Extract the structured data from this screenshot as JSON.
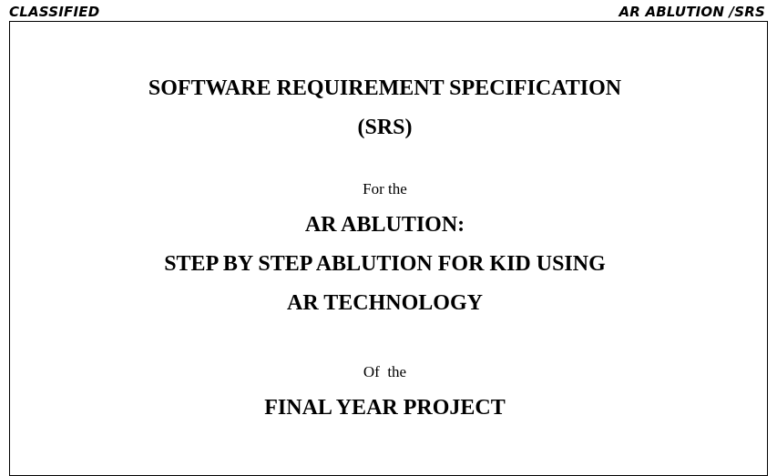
{
  "header": {
    "left": "CLASSIFIED",
    "right": "AR ABLUTION /SRS"
  },
  "title": {
    "line1": "SOFTWARE REQUIREMENT SPECIFICATION",
    "line2": "(SRS)"
  },
  "for_the": "For the",
  "project": {
    "line1": "AR ABLUTION:",
    "line2": "STEP BY STEP ABLUTION FOR KID USING",
    "line3": "AR TECHNOLOGY"
  },
  "of_the": "Of  the",
  "final": "FINAL YEAR PROJECT"
}
